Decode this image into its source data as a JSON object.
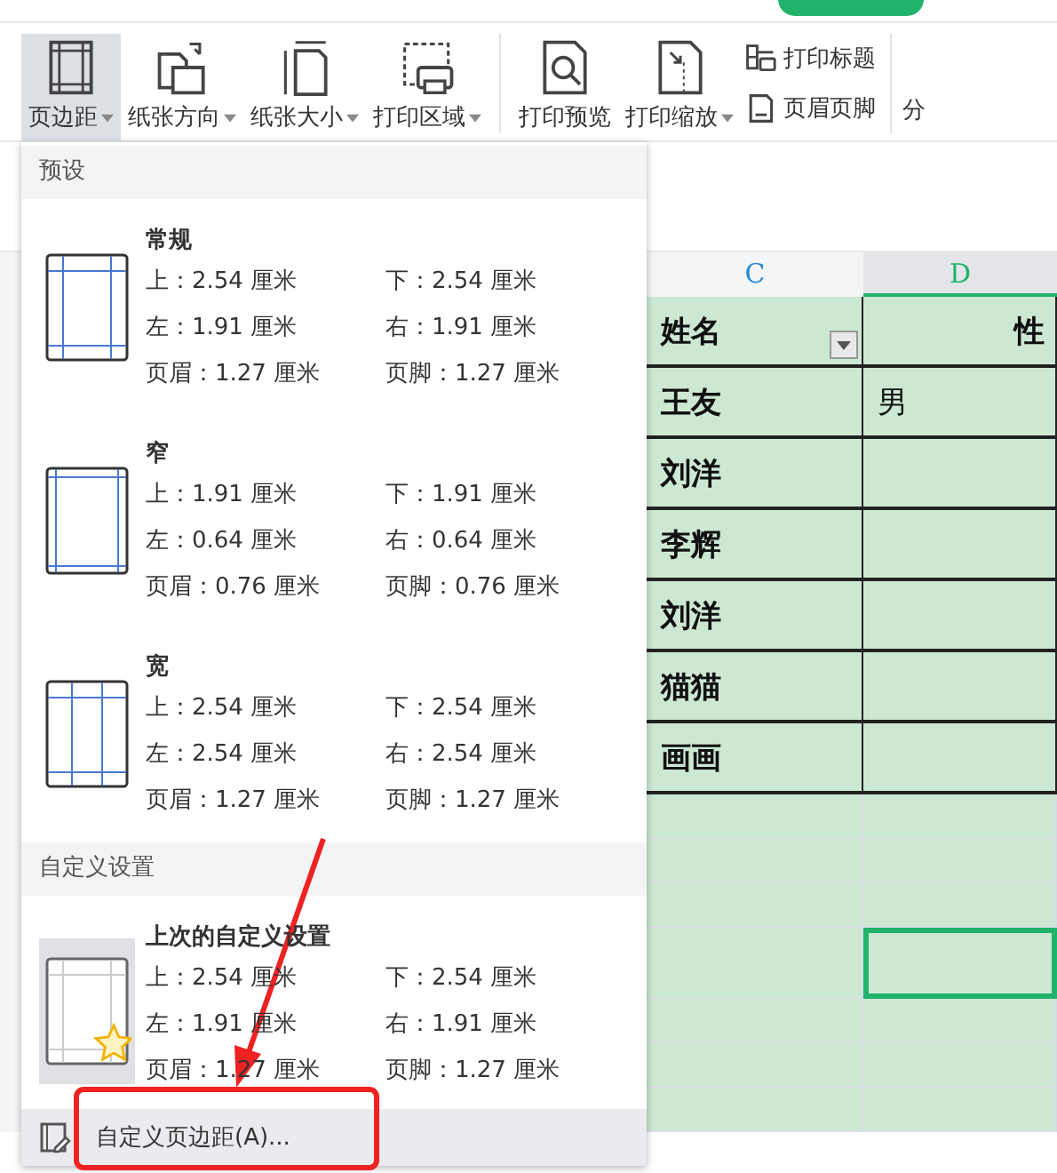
{
  "ribbon": {
    "large_buttons": [
      {
        "label": "页边距",
        "kind": "margins",
        "caret": true,
        "selected": true
      },
      {
        "label": "纸张方向",
        "kind": "orientation",
        "caret": true,
        "selected": false
      },
      {
        "label": "纸张大小",
        "kind": "size",
        "caret": true,
        "selected": false
      },
      {
        "label": "打印区域",
        "kind": "area",
        "caret": true,
        "selected": false
      },
      {
        "label": "打印预览",
        "kind": "preview",
        "caret": false,
        "selected": false
      },
      {
        "label": "打印缩放",
        "kind": "scale",
        "caret": true,
        "selected": false
      }
    ],
    "small_buttons": [
      {
        "label": "打印标题",
        "kind": "titles"
      },
      {
        "label": "页眉页脚",
        "kind": "header_footer"
      }
    ],
    "cut_label": "分"
  },
  "sheet": {
    "columns": [
      {
        "label": "C",
        "selected": false
      },
      {
        "label": "D",
        "selected": true
      }
    ],
    "rows": [
      {
        "cells": [
          {
            "text": "姓名",
            "filter": true,
            "selected": false
          },
          {
            "text": "性",
            "selected": false
          }
        ]
      },
      {
        "cells": [
          {
            "text": "王友",
            "selected": false
          },
          {
            "text": "男",
            "selected": false
          }
        ]
      },
      {
        "cells": [
          {
            "text": "刘洋",
            "selected": false
          },
          {
            "selected": false
          }
        ]
      },
      {
        "cells": [
          {
            "text": "李辉",
            "selected": false
          },
          {
            "selected": false
          }
        ]
      },
      {
        "cells": [
          {
            "text": "刘洋",
            "selected": false
          },
          {
            "selected": false
          }
        ]
      },
      {
        "cells": [
          {
            "text": "猫猫",
            "selected": false
          },
          {
            "selected": false
          }
        ]
      },
      {
        "cells": [
          {
            "text": "画画",
            "selected": false
          },
          {
            "selected": false
          }
        ]
      },
      {
        "cells": [
          {
            "selected": false
          },
          {
            "selected": false
          }
        ]
      },
      {
        "cells": [
          {
            "selected": false
          },
          {
            "selected": false
          }
        ]
      },
      {
        "cells": [
          {
            "selected": false
          },
          {
            "selected": false
          }
        ]
      },
      {
        "cells": [
          {
            "selected": false
          },
          {
            "selected": true
          }
        ]
      },
      {
        "cells": [
          {
            "selected": false
          },
          {
            "selected": false
          }
        ]
      },
      {
        "cells": [
          {
            "selected": false
          },
          {
            "selected": false
          }
        ]
      },
      {
        "cells": [
          {
            "selected": false
          },
          {
            "selected": false
          }
        ]
      }
    ]
  },
  "menu": {
    "sections": [
      {
        "title": "预设",
        "items": [
          {
            "kind": "normal",
            "title": "常规",
            "selected": false,
            "values": [
              "上：2.54 厘米",
              "下：2.54 厘米",
              "左：1.91 厘米",
              "右：1.91 厘米",
              "页眉：1.27 厘米",
              "页脚：1.27 厘米"
            ]
          },
          {
            "kind": "narrow",
            "title": "窄",
            "selected": false,
            "values": [
              "上：1.91 厘米",
              "下：1.91 厘米",
              "左：0.64 厘米",
              "右：0.64 厘米",
              "页眉：0.76 厘米",
              "页脚：0.76 厘米"
            ]
          },
          {
            "kind": "wide",
            "title": "宽",
            "selected": false,
            "values": [
              "上：2.54 厘米",
              "下：2.54 厘米",
              "左：2.54 厘米",
              "右：2.54 厘米",
              "页眉：1.27 厘米",
              "页脚：1.27 厘米"
            ]
          }
        ]
      },
      {
        "title": "自定义设置",
        "items": [
          {
            "kind": "custom",
            "title": "上次的自定义设置",
            "selected": true,
            "values": [
              "上：2.54 厘米",
              "下：2.54 厘米",
              "左：1.91 厘米",
              "右：1.91 厘米",
              "页眉：1.27 厘米",
              "页脚：1.27 厘米"
            ]
          }
        ]
      }
    ],
    "footer": {
      "label": "自定义页边距(A)..."
    }
  }
}
